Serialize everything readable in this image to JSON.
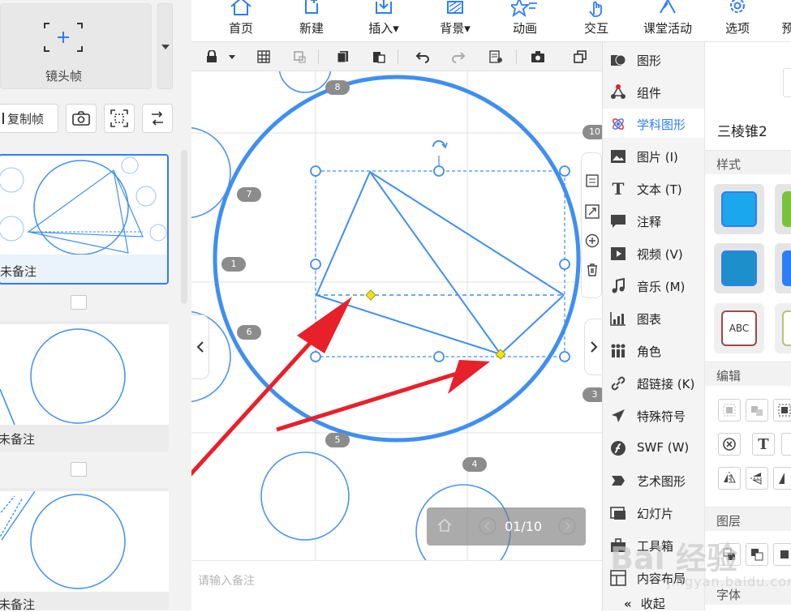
{
  "left_panel": {
    "camera_frame_label": "镜头帧",
    "copy_frame_label": "复制帧",
    "thumbnails": [
      {
        "note": "未备注"
      },
      {
        "note": "未备注"
      },
      {
        "note": "未备注"
      }
    ]
  },
  "toolbar": {
    "items": [
      {
        "label": "首页",
        "icon": "home-icon"
      },
      {
        "label": "新建",
        "icon": "new-icon"
      },
      {
        "label": "插入▾",
        "icon": "insert-icon"
      },
      {
        "label": "背景▾",
        "icon": "background-icon"
      },
      {
        "label": "动画",
        "icon": "animation-icon"
      },
      {
        "label": "交互",
        "icon": "interaction-icon"
      },
      {
        "label": "课堂活动",
        "icon": "classroom-icon"
      },
      {
        "label": "选项",
        "icon": "gear-icon"
      },
      {
        "label": "预",
        "icon": "preview-icon"
      }
    ]
  },
  "canvas": {
    "path_numbers": [
      "8",
      "7",
      "1",
      "6",
      "5",
      "4",
      "10",
      "3"
    ],
    "pager": {
      "text": "01/10"
    },
    "notes_placeholder": "请输入备注"
  },
  "insert_menu": {
    "items": [
      {
        "label": "图形",
        "icon": "shape-icon"
      },
      {
        "label": "组件",
        "icon": "component-icon"
      },
      {
        "label": "学科图形",
        "icon": "subject-shape-icon",
        "active": true
      },
      {
        "label": "图片 (I)",
        "icon": "image-icon"
      },
      {
        "label": "文本 (T)",
        "icon": "text-icon"
      },
      {
        "label": "注释",
        "icon": "comment-icon"
      },
      {
        "label": "视频 (V)",
        "icon": "video-icon"
      },
      {
        "label": "音乐 (M)",
        "icon": "music-icon"
      },
      {
        "label": "图表",
        "icon": "chart-icon"
      },
      {
        "label": "角色",
        "icon": "character-icon"
      },
      {
        "label": "超链接 (K)",
        "icon": "link-icon"
      },
      {
        "label": "特殊符号",
        "icon": "plane-icon"
      },
      {
        "label": "SWF (W)",
        "icon": "swf-icon"
      },
      {
        "label": "艺术图形",
        "icon": "art-shape-icon"
      },
      {
        "label": "幻灯片",
        "icon": "slide-icon"
      },
      {
        "label": "工具箱",
        "icon": "toolbox-icon"
      },
      {
        "label": "内容布局",
        "icon": "layout-icon"
      }
    ],
    "collapse_label": "收起"
  },
  "properties": {
    "object_name": "三棱锥2",
    "sections": {
      "style": "样式",
      "edit": "编辑",
      "layer": "图层",
      "font": "字体"
    },
    "swatch_text": "ABC",
    "edit_text_icon": "T"
  },
  "watermark": {
    "text": "Bai 经验",
    "sub": "jingyan.baidu.com"
  },
  "colors": {
    "accent": "#2f7df6",
    "shape_blue": "#3f8ff0",
    "arrow_red": "#e8202a",
    "handle_yellow": "#f5e216"
  }
}
